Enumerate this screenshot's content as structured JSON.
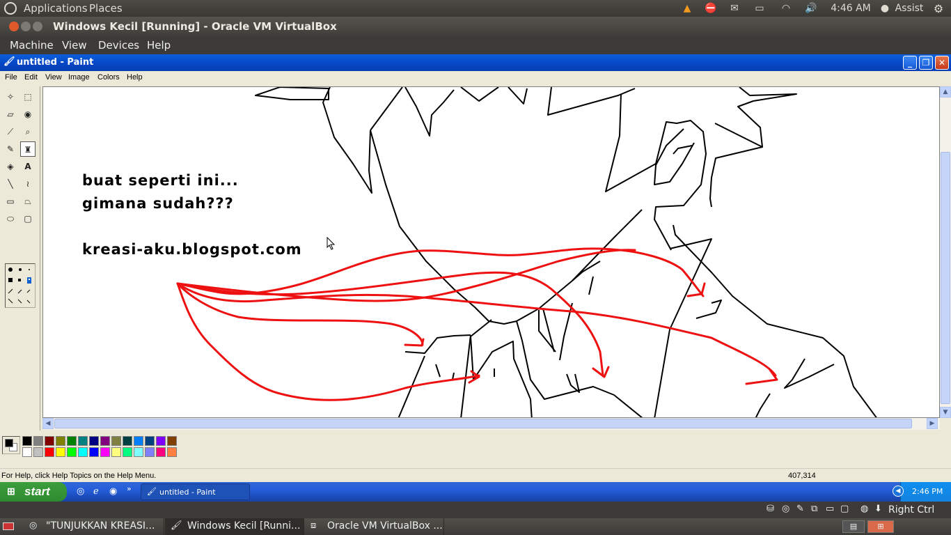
{
  "ubuntu_panel": {
    "applications": "Applications",
    "places": "Places",
    "clock": "4:46 AM",
    "user": "Assist"
  },
  "vbox": {
    "title": "Windows Kecil [Running] - Oracle VM VirtualBox",
    "menu": [
      "Machine",
      "View",
      "Devices",
      "Help"
    ],
    "host_key": "Right Ctrl"
  },
  "paint": {
    "title": "untitled - Paint",
    "menu": [
      "File",
      "Edit",
      "View",
      "Image",
      "Colors",
      "Help"
    ],
    "canvas_text": {
      "line1": "buat seperti ini...",
      "line2": "gimana sudah???",
      "line3": "kreasi-aku.blogspot.com"
    },
    "status_help": "For Help, click Help Topics on the Help Menu.",
    "status_coords": "407,314",
    "palette_top": [
      "#000000",
      "#808080",
      "#800000",
      "#808000",
      "#008000",
      "#008080",
      "#000080",
      "#800080",
      "#808040",
      "#004040",
      "#0080ff",
      "#004080",
      "#8000ff",
      "#804000"
    ],
    "palette_bottom": [
      "#ffffff",
      "#c0c0c0",
      "#ff0000",
      "#ffff00",
      "#00ff00",
      "#00ffff",
      "#0000ff",
      "#ff00ff",
      "#ffff80",
      "#00ff80",
      "#80ffff",
      "#8080ff",
      "#ff0080",
      "#ff8040"
    ],
    "stroke_color": "#ff0000"
  },
  "xp_taskbar": {
    "start": "start",
    "task": "untitled - Paint",
    "clock": "2:46 PM"
  },
  "ubuntu_taskbar": {
    "items": [
      "\"TUNJUKKAN KREASI...",
      "Windows Kecil [Runni...",
      "Oracle VM VirtualBox ..."
    ]
  }
}
